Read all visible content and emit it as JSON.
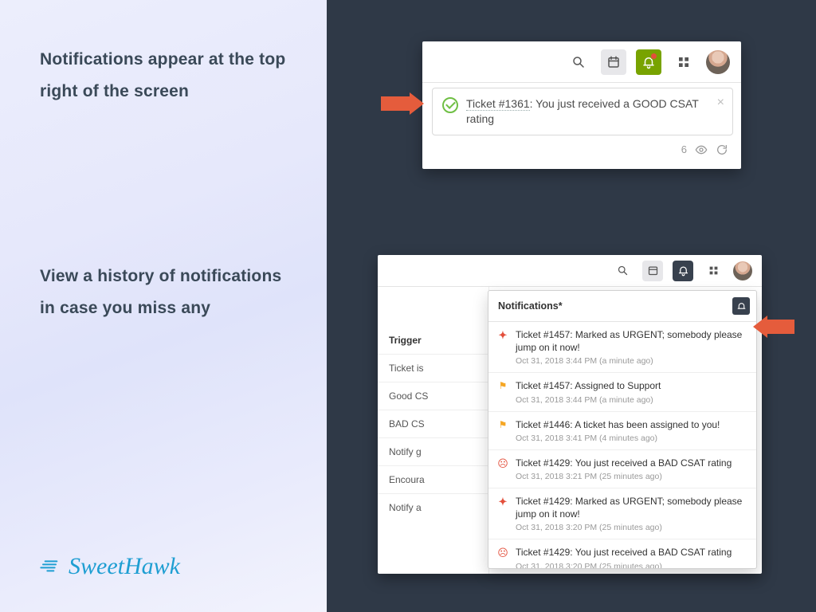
{
  "left": {
    "headline1": "Notifications appear at the top right of the screen",
    "headline2": "View a history of notifications in case you miss any",
    "brand": "SweetHawk"
  },
  "shot1": {
    "toast_ticket": "Ticket #1361",
    "toast_msg_tail": ": You just received a GOOD CSAT rating",
    "footer_count": "6"
  },
  "shot2": {
    "trigger_header": "Trigger",
    "trigger_rows": [
      "Ticket is",
      "Good CS",
      "BAD CS",
      "Notify g",
      "Encoura",
      "Notify a"
    ],
    "notif_header": "Notifications*",
    "items": [
      {
        "icon": "bolt",
        "msg": "Ticket #1457: Marked as URGENT; somebody please jump on it now!",
        "time": "Oct 31, 2018 3:44 PM (a minute ago)"
      },
      {
        "icon": "flag",
        "msg": "Ticket #1457: Assigned to Support",
        "time": "Oct 31, 2018 3:44 PM (a minute ago)"
      },
      {
        "icon": "flag",
        "msg": "Ticket #1446: A ticket has been assigned to you!",
        "time": "Oct 31, 2018 3:41 PM (4 minutes ago)"
      },
      {
        "icon": "sad",
        "msg": "Ticket #1429: You just received a BAD CSAT rating",
        "time": "Oct 31, 2018 3:21 PM (25 minutes ago)"
      },
      {
        "icon": "bolt",
        "msg": "Ticket #1429: Marked as URGENT; somebody please jump on it now!",
        "time": "Oct 31, 2018 3:20 PM (25 minutes ago)"
      },
      {
        "icon": "sad",
        "msg": "Ticket #1429: You just received a BAD CSAT rating",
        "time": "Oct 31, 2018 3:20 PM (25 minutes ago)"
      }
    ]
  }
}
